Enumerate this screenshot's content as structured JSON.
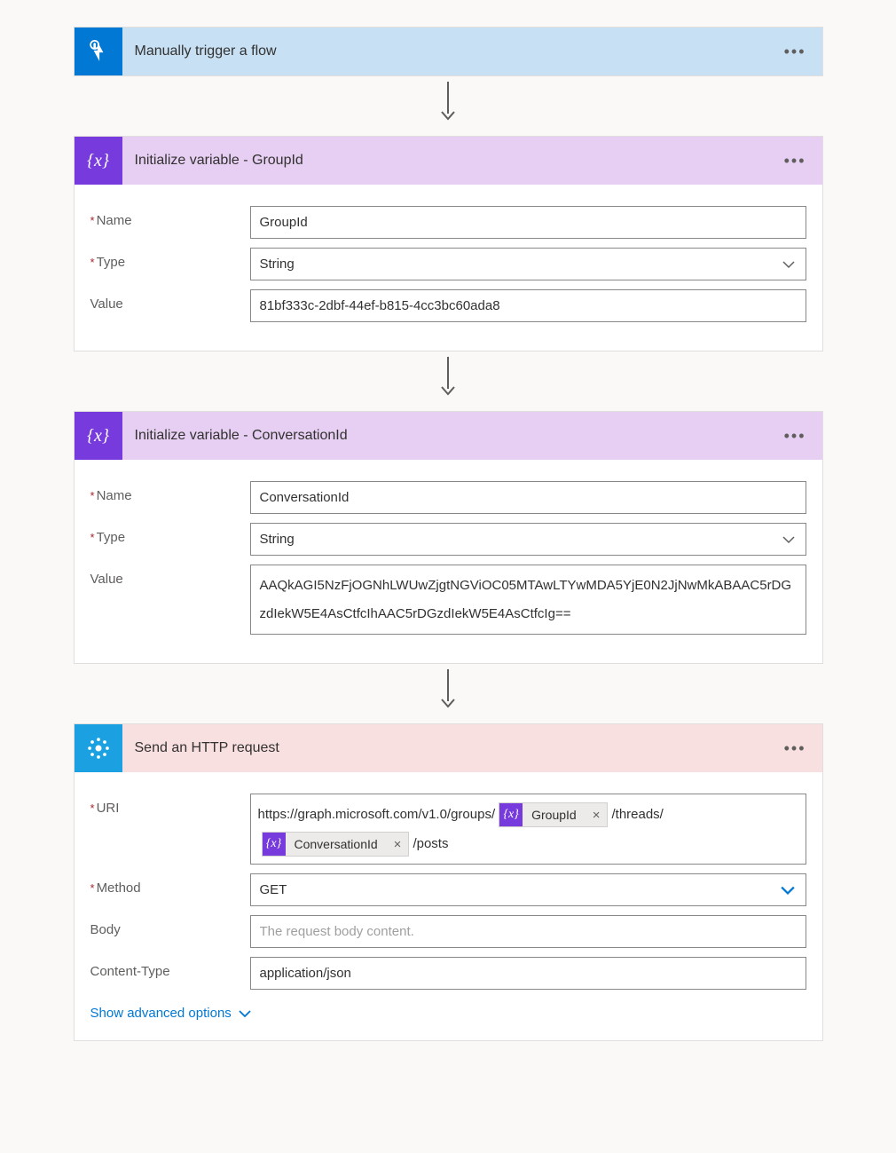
{
  "step1": {
    "title": "Manually trigger a flow"
  },
  "step2": {
    "title": "Initialize variable - GroupId",
    "name_label": "Name",
    "name_value": "GroupId",
    "type_label": "Type",
    "type_value": "String",
    "value_label": "Value",
    "value_value": "81bf333c-2dbf-44ef-b815-4cc3bc60ada8"
  },
  "step3": {
    "title": "Initialize variable - ConversationId",
    "name_label": "Name",
    "name_value": "ConversationId",
    "type_label": "Type",
    "type_value": "String",
    "value_label": "Value",
    "value_value": "AAQkAGI5NzFjOGNhLWUwZjgtNGViOC05MTAwLTYwMDA5YjE0N2JjNwMkABAAC5rDGzdIekW5E4AsCtfcIhAAC5rDGzdIekW5E4AsCtfcIg=="
  },
  "step4": {
    "title": "Send an HTTP request",
    "uri_label": "URI",
    "uri_prefix": "https://graph.microsoft.com/v1.0/groups/",
    "uri_mid": "/threads/",
    "uri_suffix": "/posts",
    "pill1": "GroupId",
    "pill2": "ConversationId",
    "method_label": "Method",
    "method_value": "GET",
    "body_label": "Body",
    "body_placeholder": "The request body content.",
    "ct_label": "Content-Type",
    "ct_value": "application/json",
    "adv": "Show advanced options"
  }
}
